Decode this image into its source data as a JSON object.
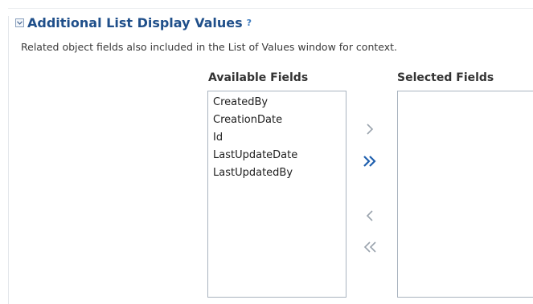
{
  "section": {
    "title": "Additional List Display Values",
    "help": "?",
    "instruction": "Related object fields also included in the List of Values window for context."
  },
  "available": {
    "header": "Available Fields",
    "items": [
      "CreatedBy",
      "CreationDate",
      "Id",
      "LastUpdateDate",
      "LastUpdatedBy"
    ]
  },
  "selected": {
    "header": "Selected Fields",
    "items": []
  },
  "shuttle": {
    "move_icon": "chevron-right-icon",
    "move_all_icon": "double-chevron-right-icon",
    "remove_icon": "chevron-left-icon",
    "remove_all_icon": "double-chevron-left-icon"
  },
  "colors": {
    "title": "#1f4f8a",
    "help": "#3d7bbf",
    "icon_disabled": "#9aa3ad",
    "icon_active": "#1f5fae"
  }
}
